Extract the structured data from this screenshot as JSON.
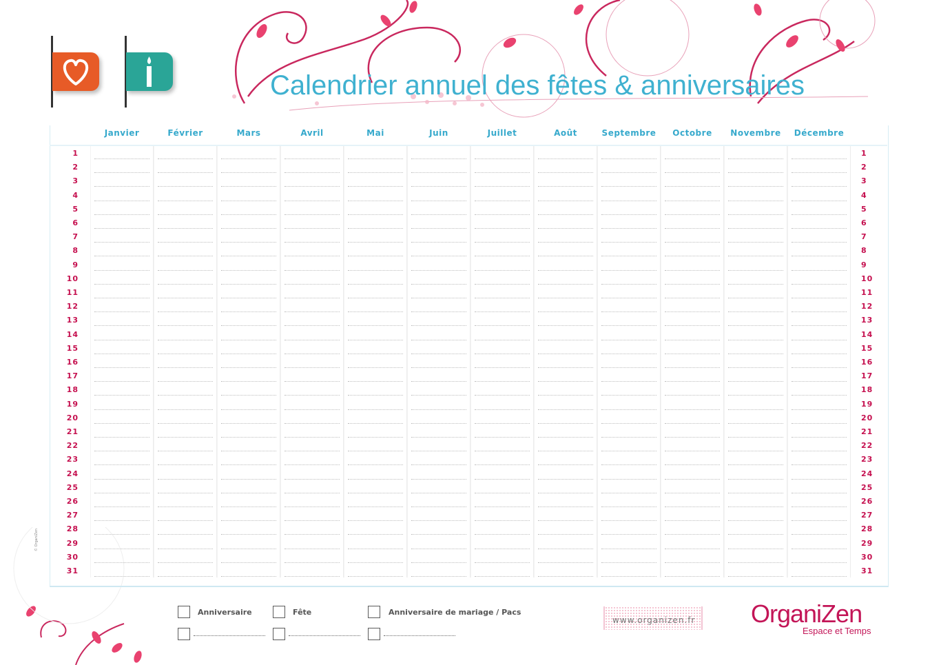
{
  "title": "Calendrier annuel des fêtes & anniversaires",
  "months": [
    "Janvier",
    "Février",
    "Mars",
    "Avril",
    "Mai",
    "Juin",
    "Juillet",
    "Août",
    "Septembre",
    "Octobre",
    "Novembre",
    "Décembre"
  ],
  "days": [
    "1",
    "2",
    "3",
    "4",
    "5",
    "6",
    "7",
    "8",
    "9",
    "10",
    "11",
    "12",
    "13",
    "14",
    "15",
    "16",
    "17",
    "18",
    "19",
    "20",
    "21",
    "22",
    "23",
    "24",
    "25",
    "26",
    "27",
    "28",
    "29",
    "30",
    "31"
  ],
  "legend": {
    "birthday": "Anniversaire",
    "feast": "Fête",
    "wedding": "Anniversaire de mariage / Pacs"
  },
  "footer": {
    "url": "www.organizen.fr",
    "logo": "OrganiZen",
    "tagline": "Espace et Temps",
    "copyright": "© OrganiZen"
  },
  "colors": {
    "title": "#3fb1d0",
    "day_numbers": "#c5104f",
    "heart_tab": "#e75b27",
    "info_tab": "#2aa597",
    "brand": "#c31557"
  },
  "icons": [
    "heart-icon",
    "candle-icon"
  ]
}
